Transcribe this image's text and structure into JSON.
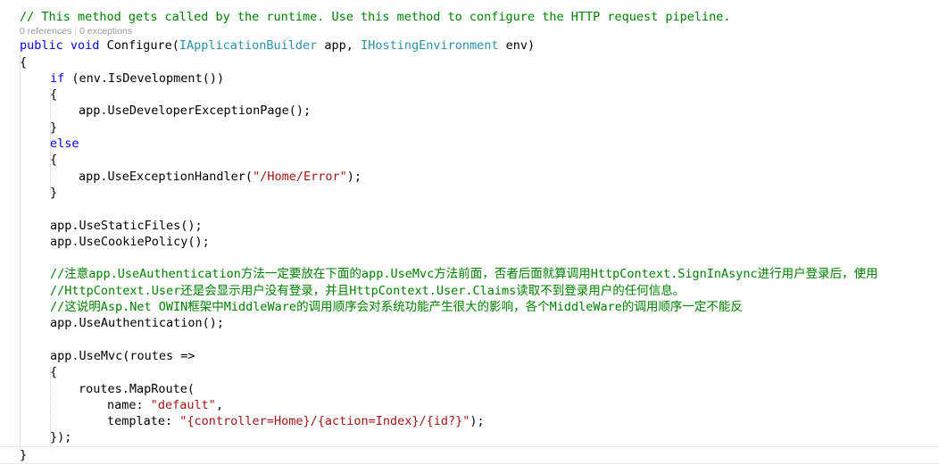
{
  "editor": {
    "language": "csharp",
    "colors": {
      "background": "#ffffff",
      "text": "#000000",
      "keyword": "#0000ff",
      "type": "#2b91af",
      "string": "#a31515",
      "comment": "#008000",
      "codelens": "#9a9a9a",
      "guide_line": "#c8c8c8",
      "current_line_border": "#e6e6e6"
    },
    "codelens": {
      "references": "0 references",
      "separator": "|",
      "exceptions": "0 exceptions"
    },
    "lines": {
      "l1_comment": "// This method gets called by the runtime. Use this method to configure the HTTP request pipeline.",
      "l2_public": "public",
      "l2_void": "void",
      "l2_configure": " Configure(",
      "l2_iapplicationbuilder": "IApplicationBuilder",
      "l2_app": " app, ",
      "l2_ihostingenvironment": "IHostingEnvironment",
      "l2_env": " env)",
      "l3_brace_open": "{",
      "l4_if": "if",
      "l4_cond": " (env.IsDevelopment())",
      "l5_brace_open": "{",
      "l6_stmt": "app.UseDeveloperExceptionPage();",
      "l7_brace_close": "}",
      "l8_else": "else",
      "l9_brace_open": "{",
      "l10_call": "app.UseExceptionHandler(",
      "l10_string": "\"/Home/Error\"",
      "l10_tail": ");",
      "l11_brace_close": "}",
      "l12_blank": "",
      "l13_staticfiles": "app.UseStaticFiles();",
      "l14_cookiepolicy": "app.UseCookiePolicy();",
      "l15_blank": "",
      "l16_cn_comment1": "//注意app.UseAuthentication方法一定要放在下面的app.UseMvc方法前面，否者后面就算调用HttpContext.SignInAsync进行用户登录后，使用",
      "l17_cn_comment2": "//HttpContext.User还是会显示用户没有登录，并且HttpContext.User.Claims读取不到登录用户的任何信息。",
      "l18_cn_comment3": "//这说明Asp.Net OWIN框架中MiddleWare的调用顺序会对系统功能产生很大的影响，各个MiddleWare的调用顺序一定不能反",
      "l19_useauth": "app.UseAuthentication();",
      "l20_blank": "",
      "l21_usemvc": "app.UseMvc(routes =>",
      "l22_brace_open": "{",
      "l23_maproute": "routes.MapRoute(",
      "l24_name_label": "name: ",
      "l24_name_value": "\"default\"",
      "l24_comma": ",",
      "l25_template_label": "template: ",
      "l25_template_value": "\"{controller=Home}/{action=Index}/{id?}\"",
      "l25_tail": ");",
      "l26_close": "});",
      "l27_brace_close": "}"
    }
  }
}
